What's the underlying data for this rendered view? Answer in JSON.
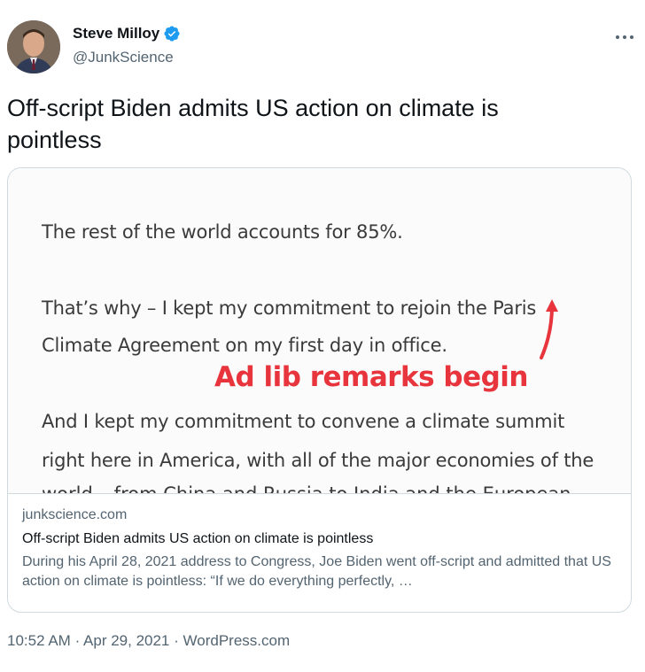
{
  "author": {
    "name": "Steve Milloy",
    "handle": "@JunkScience",
    "verified": true,
    "avatar_icon": "avatar-photo"
  },
  "tweet": {
    "text": "Off-script Biden admits US action on climate is pointless"
  },
  "card": {
    "image": {
      "line1": "The rest of the world accounts for 85%.",
      "line2": "That’s why – I kept my commitment to rejoin the Paris",
      "line3": "Climate Agreement on my first day in office.",
      "annotation": "Ad lib remarks begin",
      "line4": "And I kept my commitment to convene a climate summit",
      "line5": "right here in America, with all of the major economies of the",
      "line6": "world – from China and Russia to India and the European"
    },
    "domain": "junkscience.com",
    "title": "Off-script Biden admits US action on climate is pointless",
    "description": "During his April 28, 2021 address to Congress, Joe Biden went off-script and admitted that US action on climate is pointless: “If we do everything perfectly, …"
  },
  "meta": {
    "time": "10:52 AM",
    "separator": "·",
    "date": "Apr 29, 2021",
    "source": "WordPress.com"
  },
  "colors": {
    "verified_blue": "#1d9bf0",
    "annotation_red": "#e8343c",
    "secondary_text": "#536471"
  }
}
